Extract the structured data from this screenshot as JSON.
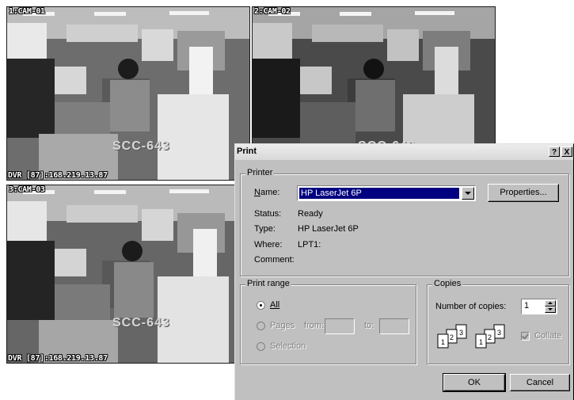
{
  "cameras": [
    {
      "label": "1:CAM-01",
      "ip": "DVR [87]:168.219.13.87",
      "watermark": "SCC-643"
    },
    {
      "label": "2:CAM-02",
      "ip": "",
      "watermark": "SCC-643"
    },
    {
      "label": "3:CAM-03",
      "ip": "DVR [87]:168.219.13.87",
      "watermark": "SCC-643"
    }
  ],
  "dialog": {
    "title": "Print",
    "help_btn": "?",
    "close_btn": "X",
    "printer": {
      "group_title": "Printer",
      "name_label": "Name:",
      "name_value": "HP LaserJet 6P",
      "properties_label": "Properties...",
      "status_label": "Status:",
      "status_value": "Ready",
      "type_label": "Type:",
      "type_value": "HP LaserJet 6P",
      "where_label": "Where:",
      "where_value": "LPT1:",
      "comment_label": "Comment:",
      "comment_value": ""
    },
    "print_range": {
      "group_title": "Print range",
      "all_label": "All",
      "pages_label": "Pages",
      "from_label": "from:",
      "to_label": "to:",
      "selection_label": "Selection"
    },
    "copies": {
      "group_title": "Copies",
      "number_label": "Number of copies:",
      "number_value": "1",
      "collate_label": "Collate"
    },
    "ok_label": "OK",
    "cancel_label": "Cancel"
  }
}
